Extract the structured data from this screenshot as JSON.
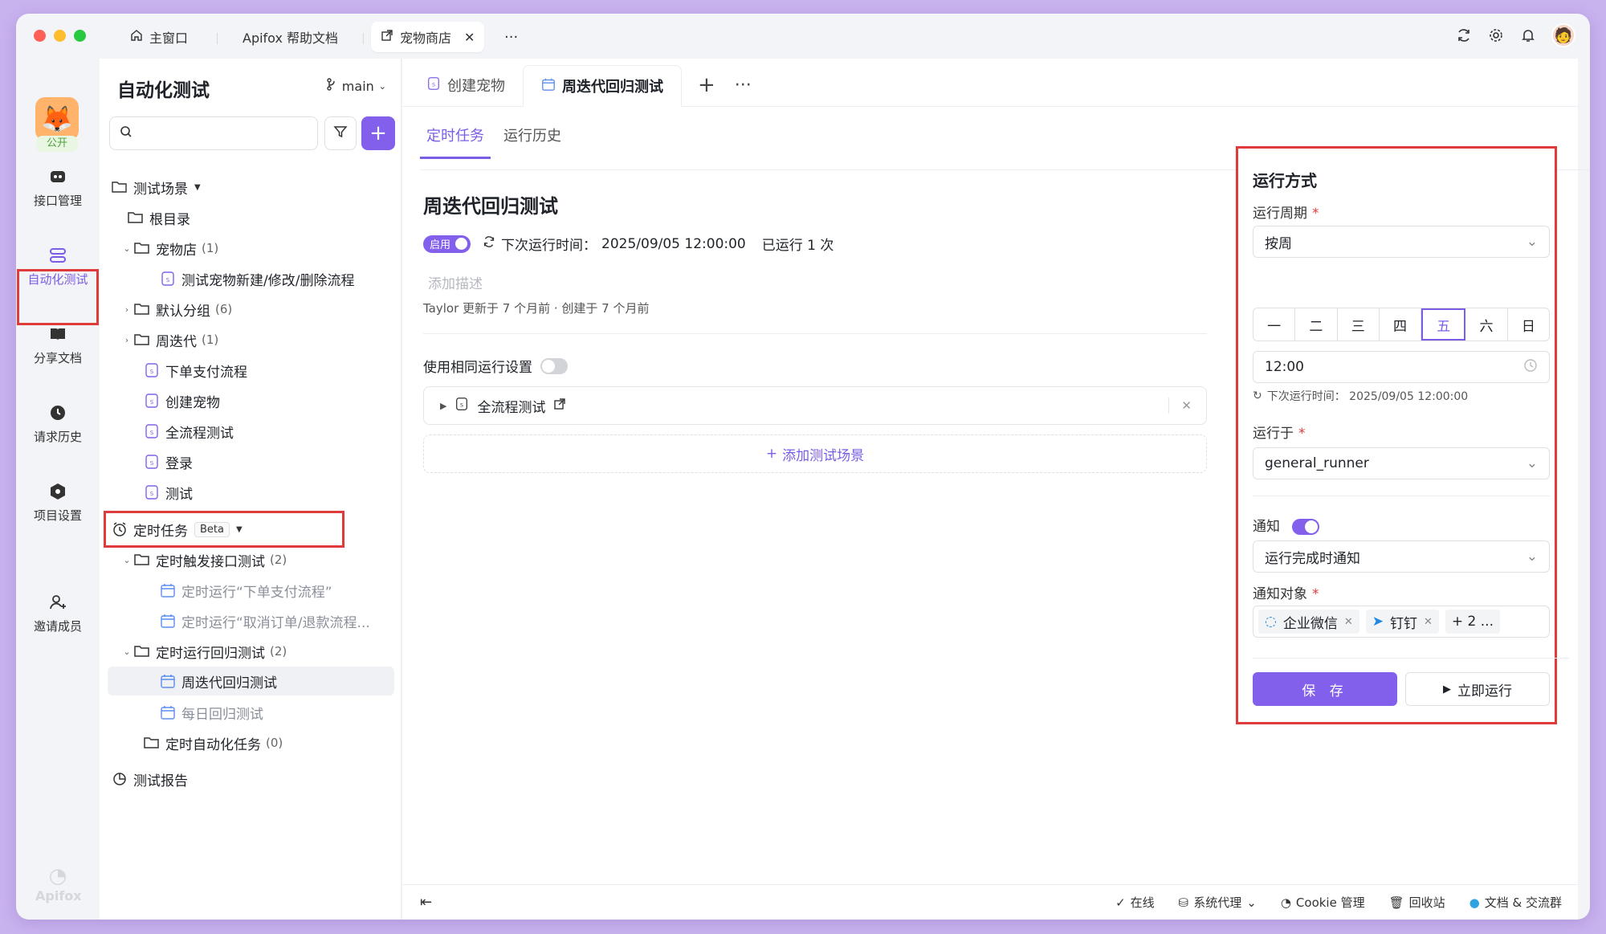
{
  "window_tabs": [
    {
      "label": "主窗口",
      "icon": "home-icon"
    },
    {
      "label": "Apifox 帮助文档"
    },
    {
      "label": "宠物商店",
      "icon": "external-link-icon",
      "active": true
    }
  ],
  "nav": {
    "public_badge": "公开",
    "items": [
      {
        "label": "接口管理",
        "icon": "api-icon"
      },
      {
        "label": "自动化测试",
        "icon": "automation-icon",
        "active": true
      },
      {
        "label": "分享文档",
        "icon": "book-icon"
      },
      {
        "label": "请求历史",
        "icon": "history-icon"
      },
      {
        "label": "项目设置",
        "icon": "settings-icon"
      },
      {
        "label": "邀请成员",
        "icon": "invite-icon"
      }
    ],
    "brand": "Apifox"
  },
  "tree": {
    "title": "自动化测试",
    "branch": "main",
    "search_placeholder": "",
    "section_scenes": "测试场景",
    "root": "根目录",
    "folder_petstore": "宠物店",
    "folder_petstore_count": "(1)",
    "item_petflow": "测试宠物新建/修改/删除流程",
    "folder_default": "默认分组",
    "folder_default_count": "(6)",
    "folder_iteration": "周迭代",
    "folder_iteration_count": "(1)",
    "item_order": "下单支付流程",
    "item_create": "创建宠物",
    "item_fullflow": "全流程测试",
    "item_login": "登录",
    "item_test": "测试",
    "section_cron": "定时任务",
    "beta": "Beta",
    "folder_trigger": "定时触发接口测试",
    "folder_trigger_count": "(2)",
    "item_cron_order": "定时运行“下单支付流程”",
    "item_cron_cancel": "定时运行“取消订单/退款流程...",
    "folder_regress": "定时运行回归测试",
    "folder_regress_count": "(2)",
    "item_weekly": "周迭代回归测试",
    "item_daily": "每日回归测试",
    "folder_auto": "定时自动化任务",
    "folder_auto_count": "(0)",
    "section_report": "测试报告"
  },
  "main": {
    "tabs": [
      {
        "label": "创建宠物"
      },
      {
        "label": "周迭代回归测试",
        "active": true
      }
    ],
    "subtabs": {
      "cron": "定时任务",
      "history": "运行历史"
    },
    "title": "周迭代回归测试",
    "enabled_label": "启用",
    "next_run_label": "下次运行时间：",
    "next_run_value": "2025/09/05 12:00:00",
    "run_count": "已运行 1 次",
    "desc_placeholder": "添加描述",
    "meta": "Taylor 更新于 7 个月前 · 创建于 7 个月前",
    "same_settings": "使用相同运行设置",
    "scene_name": "全流程测试",
    "add_scene": "添加测试场景"
  },
  "run_panel": {
    "title": "运行方式",
    "cycle_label": "运行周期",
    "cycle_value": "按周",
    "days": [
      "一",
      "二",
      "三",
      "四",
      "五",
      "六",
      "日"
    ],
    "selected_day": "五",
    "time_value": "12:00",
    "next_run": "下次运行时间：  2025/09/05 12:00:00",
    "runner_label": "运行于",
    "runner_value": "general_runner",
    "notify_label": "通知",
    "notify_enabled": true,
    "notify_when": "运行完成时通知",
    "notify_target_label": "通知对象",
    "targets": [
      "企业微信",
      "钉钉"
    ],
    "more": "+ 2 ...",
    "save": "保 存",
    "run_now": "立即运行"
  },
  "statusbar": {
    "online": "在线",
    "proxy": "系统代理",
    "cookie": "Cookie 管理",
    "recycle": "回收站",
    "docs": "文档 & 交流群"
  },
  "colors": {
    "accent": "#8260ec",
    "highlight": "#e03b3b"
  }
}
